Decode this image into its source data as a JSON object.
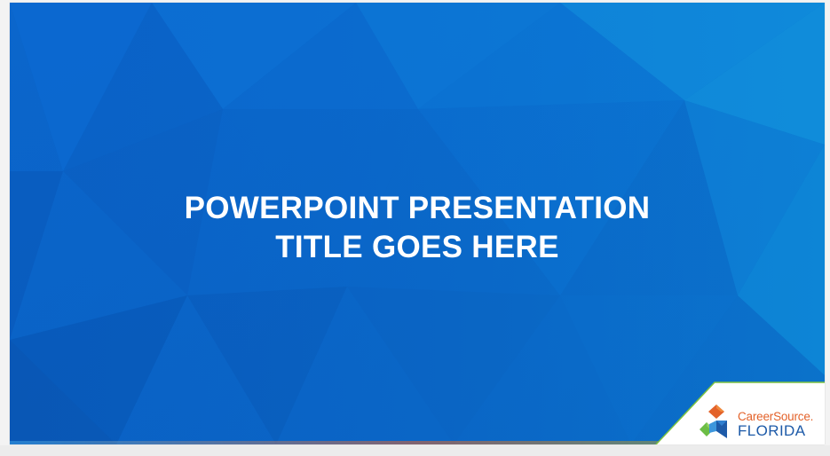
{
  "slide": {
    "title_line1": "POWERPOINT PRESENTATION",
    "title_line2": "TITLE GOES HERE"
  },
  "logo": {
    "name_top": "CareerSource.",
    "name_bottom": "FLORIDA"
  },
  "colors": {
    "background": "#0a64c8",
    "title": "#ffffff",
    "logo_orange": "#e3622a",
    "logo_blue": "#1d5aa8",
    "logo_green": "#6cbd45",
    "panel_border": "#7dc242"
  }
}
